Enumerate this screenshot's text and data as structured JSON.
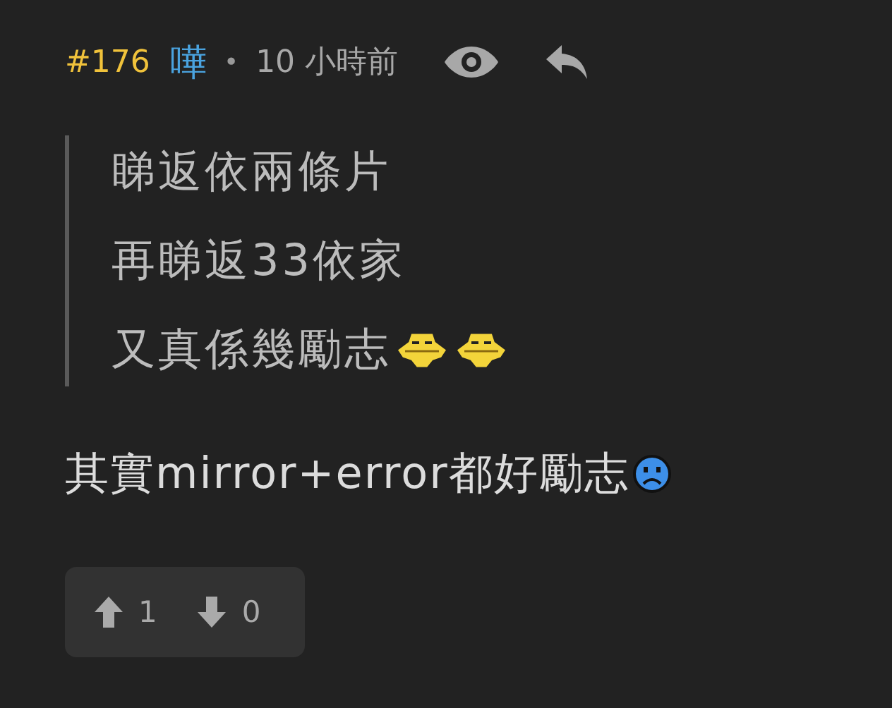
{
  "post": {
    "number": "#176",
    "author": "嘩",
    "separator": "•",
    "time": "10 小時前"
  },
  "quote": [
    {
      "text": "睇返依兩條片"
    },
    {
      "text": "再睇返33依家"
    },
    {
      "text": "又真係幾勵志",
      "emoticons": [
        {
          "kind": "smug"
        },
        {
          "kind": "smug"
        }
      ]
    }
  ],
  "body": {
    "text": "其實mirror+error都好勵志",
    "emoticons": [
      {
        "kind": "sad"
      }
    ]
  },
  "votes": {
    "up": "1",
    "down": "0"
  }
}
